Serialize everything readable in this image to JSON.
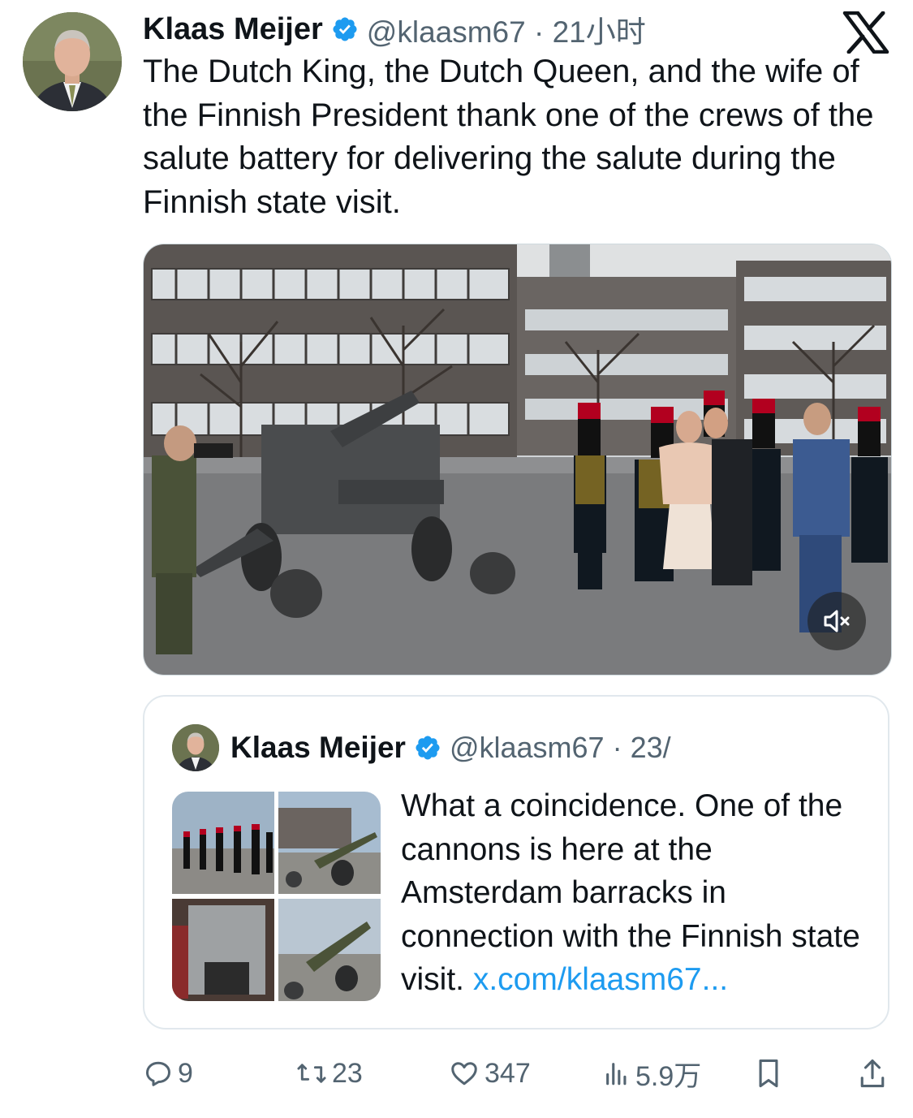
{
  "author": {
    "name": "Klaas Meijer",
    "handle": "@klaasm67",
    "separator": " · ",
    "time": "21小时",
    "verified": true
  },
  "tweet": {
    "text": "The Dutch King, the Dutch Queen, and the wife of the Finnish President thank one of the crews of the salute battery for delivering the salute during the Finnish state visit."
  },
  "media": {
    "type": "video",
    "muted": true
  },
  "quoted_tweet": {
    "name": "Klaas Meijer",
    "handle": "@klaasm67",
    "separator": " · ",
    "time": "23/",
    "text": "What a coincidence. One of the cannons is here at the Amsterdam barracks in connection with the Finnish state visit. ",
    "link_text": "x.com/klaasm67..."
  },
  "actions": {
    "replies": "9",
    "reposts": "23",
    "likes": "347",
    "views": "5.9万"
  },
  "colors": {
    "text": "#0f1419",
    "secondary": "#536471",
    "link": "#1d9bf0",
    "verified": "#1d9bf0",
    "border": "#e1e8ed"
  },
  "icons": [
    "x-logo-icon",
    "verified-badge-icon",
    "mute-icon",
    "reply-icon",
    "repost-icon",
    "like-icon",
    "views-icon",
    "bookmark-icon",
    "share-icon"
  ]
}
